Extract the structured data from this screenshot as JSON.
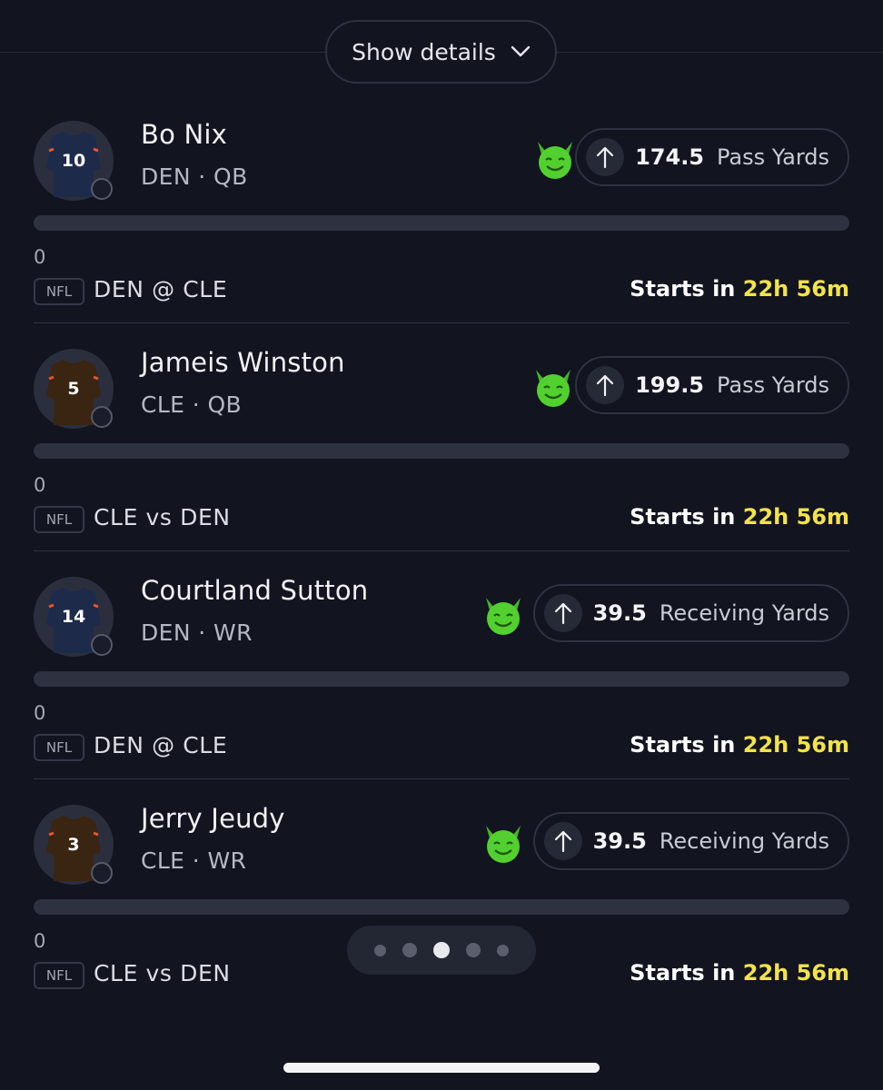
{
  "header": {
    "show_details_label": "Show details"
  },
  "picks": [
    {
      "name": "Bo Nix",
      "team": "DEN",
      "position": "QB",
      "jersey_number": "10",
      "jersey_color": "#1d2a4a",
      "line": "174.5",
      "stat": "Pass Yards",
      "direction": "up",
      "progress_count": "0",
      "league": "NFL",
      "matchup": "DEN @ CLE",
      "starts_label": "Starts in",
      "starts_time": "22h 56m"
    },
    {
      "name": "Jameis Winston",
      "team": "CLE",
      "position": "QB",
      "jersey_number": "5",
      "jersey_color": "#3a2412",
      "line": "199.5",
      "stat": "Pass Yards",
      "direction": "up",
      "progress_count": "0",
      "league": "NFL",
      "matchup": "CLE vs DEN",
      "starts_label": "Starts in",
      "starts_time": "22h 56m"
    },
    {
      "name": "Courtland Sutton",
      "team": "DEN",
      "position": "WR",
      "jersey_number": "14",
      "jersey_color": "#1d2a4a",
      "line": "39.5",
      "stat": "Receiving Yards",
      "direction": "up",
      "progress_count": "0",
      "league": "NFL",
      "matchup": "DEN @ CLE",
      "starts_label": "Starts in",
      "starts_time": "22h 56m"
    },
    {
      "name": "Jerry Jeudy",
      "team": "CLE",
      "position": "WR",
      "jersey_number": "3",
      "jersey_color": "#3a2412",
      "line": "39.5",
      "stat": "Receiving Yards",
      "direction": "up",
      "progress_count": "0",
      "league": "NFL",
      "matchup": "CLE vs DEN",
      "starts_label": "Starts in",
      "starts_time": "22h 56m"
    }
  ],
  "pager": {
    "total": 5,
    "active_index": 2
  },
  "colors": {
    "background": "#121420",
    "accent_time": "#f3e34a",
    "demon_green": "#4fd12e",
    "jersey_trim_orange": "#e4572e"
  },
  "icons": {
    "chevron": "chevron-down-icon",
    "arrow": "arrow-up-icon",
    "demon": "demon-emoji-icon",
    "clock": "clock-icon"
  }
}
